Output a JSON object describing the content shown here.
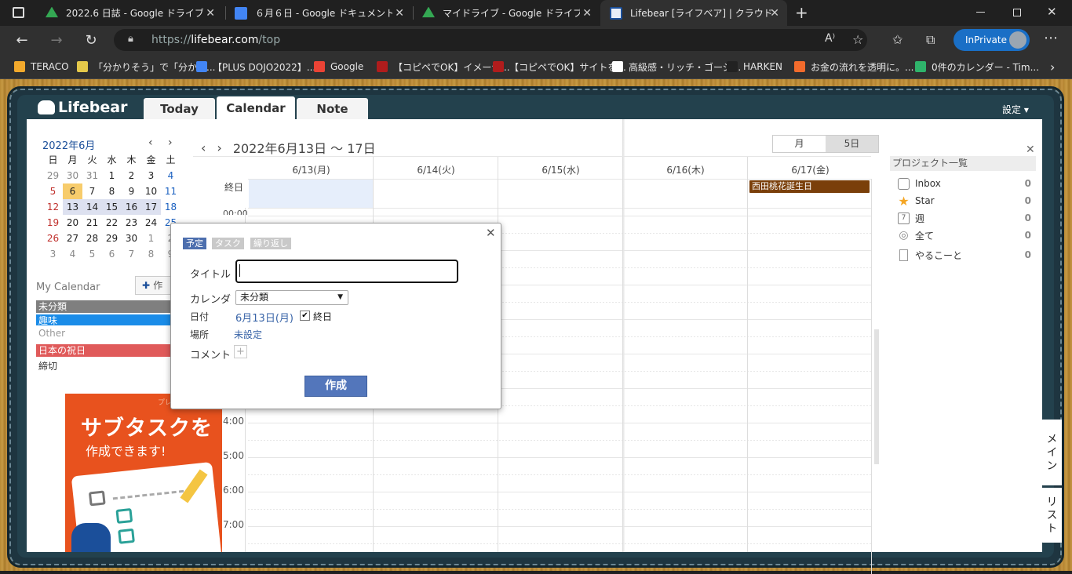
{
  "browser": {
    "tabs": [
      {
        "title": "2022.6 日誌 - Google ドライブ",
        "favicon": "google-drive-icon",
        "color": "#34a853"
      },
      {
        "title": "６月６日 - Google ドキュメント",
        "favicon": "google-docs-icon",
        "color": "#4285f4"
      },
      {
        "title": "マイドライブ - Google ドライブ",
        "favicon": "google-drive-icon",
        "color": "#34a853"
      },
      {
        "title": "Lifebear [ライフベア] | クラウド型電子",
        "favicon": "lifebear-icon",
        "color": "#1b4f9a"
      }
    ],
    "url_scheme": "https://",
    "url_host": "lifebear.com",
    "url_path": "/top",
    "inprivate_label": "InPrivate",
    "bookmarks": [
      {
        "label": "TERACO",
        "color": "#f2a92c"
      },
      {
        "label": "「分かりそう」で「分から...",
        "color": "#e4c84a"
      },
      {
        "label": "【PLUS DOJO2022】...",
        "color": "#4285f4"
      },
      {
        "label": "Google",
        "color": "#ea4335"
      },
      {
        "label": "【コピペでOK】イメージ...",
        "color": "#b01c1c"
      },
      {
        "label": "【コピペでOK】サイトを...",
        "color": "#b01c1c"
      },
      {
        "label": "高級感・リッチ・ゴージ...",
        "color": "#ffffff"
      },
      {
        "label": "HARKEN",
        "color": "#222222"
      },
      {
        "label": "お金の流れを透明に。...",
        "color": "#f26b2c"
      },
      {
        "label": "0件のカレンダー - Tim...",
        "color": "#2fb36b"
      }
    ]
  },
  "app": {
    "logo": "Lifebear",
    "tabs": [
      "Today",
      "Calendar",
      "Note"
    ],
    "active_tab": "Calendar",
    "settings_label": "設定 ▾"
  },
  "mini_calendar": {
    "month_label": "2022年6月",
    "weekdays": [
      "日",
      "月",
      "火",
      "水",
      "木",
      "金",
      "土"
    ],
    "weeks": [
      [
        "29",
        "30",
        "31",
        "1",
        "2",
        "3",
        "4"
      ],
      [
        "5",
        "6",
        "7",
        "8",
        "9",
        "10",
        "11"
      ],
      [
        "12",
        "13",
        "14",
        "15",
        "16",
        "17",
        "18"
      ],
      [
        "19",
        "20",
        "21",
        "22",
        "23",
        "24",
        "25"
      ],
      [
        "26",
        "27",
        "28",
        "29",
        "30",
        "1",
        "2"
      ],
      [
        "3",
        "4",
        "5",
        "6",
        "7",
        "8",
        "9"
      ]
    ],
    "today": "6"
  },
  "my_calendar": {
    "label": "My Calendar",
    "create_label": "作",
    "items": [
      {
        "label": "未分類",
        "bg": "#7f7f7f",
        "fg": "#ffffff"
      },
      {
        "label": "趣味",
        "bg": "#1a8ce8",
        "fg": "#ffffff"
      },
      {
        "label": "Other",
        "bg": "#ffffff",
        "fg": "#999999"
      },
      {
        "label": "日本の祝日",
        "bg": "#e05a5a",
        "fg": "#ffffff"
      },
      {
        "label": "締切",
        "bg": "#ffffff",
        "fg": "#333333"
      }
    ]
  },
  "ad": {
    "line1": "サブタスクを",
    "line2": "作成できます!",
    "tag": "プレ"
  },
  "calendar": {
    "range_label": "2022年6月13日 〜 17日",
    "view_options": [
      "月",
      "5日"
    ],
    "active_view": "5日",
    "days": [
      "6/13(月)",
      "6/14(火)",
      "6/15(水)",
      "6/16(木)",
      "6/17(金)"
    ],
    "allday_label": "終日",
    "event": "西田桃花誕生日",
    "hours_partial": "00:00",
    "hours": [
      "4:00",
      "5:00",
      "6:00",
      "7:00"
    ]
  },
  "projects": {
    "header": "プロジェクト一覧",
    "items": [
      {
        "label": "Inbox",
        "count": "0",
        "icon": "inbox-icon"
      },
      {
        "label": "Star",
        "count": "0",
        "icon": "star-icon"
      },
      {
        "label": "週",
        "count": "0",
        "icon": "week-calendar-icon"
      },
      {
        "label": "全て",
        "count": "0",
        "icon": "all-rings-icon"
      },
      {
        "label": "やるこーと",
        "count": "0",
        "icon": "document-icon"
      }
    ]
  },
  "side_tabs": {
    "main": "メイン",
    "list": "リスト"
  },
  "dialog": {
    "tabs": [
      "予定",
      "タスク",
      "繰り返し"
    ],
    "title_label": "タイトル",
    "title_value": "",
    "calendar_label": "カレンダ",
    "calendar_value": "未分類",
    "date_label": "日付",
    "date_value": "6月13日(月)",
    "allday_label": "終日",
    "allday_checked": true,
    "place_label": "場所",
    "place_value": "未設定",
    "comment_label": "コメント",
    "create_label": "作成"
  }
}
